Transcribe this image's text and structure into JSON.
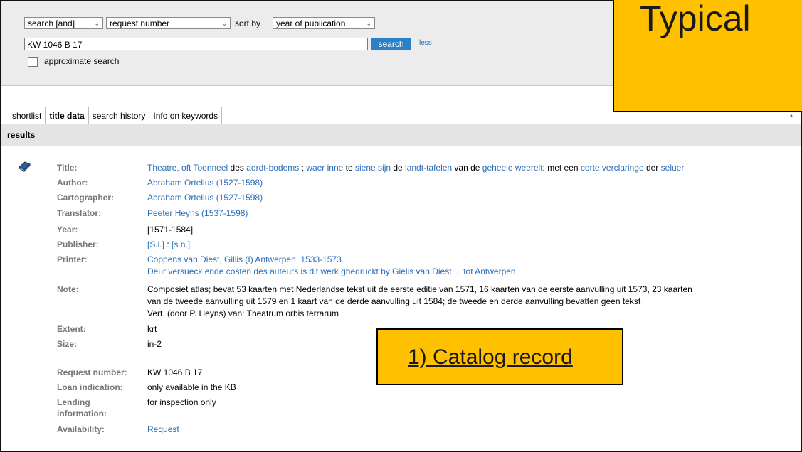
{
  "search": {
    "operator": "search [and]",
    "field": "request number",
    "sort_label": "sort by",
    "sort": "year of publication",
    "query": "KW 1046 B 17",
    "button": "search",
    "less": "less",
    "approximate": "approximate search"
  },
  "tabs": [
    {
      "label": "shortlist"
    },
    {
      "label": "title data"
    },
    {
      "label": "search history"
    },
    {
      "label": "Info on keywords"
    }
  ],
  "results_label": "results",
  "record": {
    "title_label": "Title:",
    "title_parts": [
      {
        "text": "Theatre, oft Toonneel",
        "link": true
      },
      {
        "text": " des ",
        "link": false
      },
      {
        "text": "aerdt-bodems",
        "link": true
      },
      {
        "text": " ; ",
        "link": false
      },
      {
        "text": "waer inne",
        "link": true
      },
      {
        "text": " te ",
        "link": false
      },
      {
        "text": "siene sijn",
        "link": true
      },
      {
        "text": " de ",
        "link": false
      },
      {
        "text": "landt-tafelen",
        "link": true
      },
      {
        "text": " van de ",
        "link": false
      },
      {
        "text": "geheele weerelt",
        "link": true
      },
      {
        "text": ": met een ",
        "link": false
      },
      {
        "text": "corte verclaringe",
        "link": true
      },
      {
        "text": " der ",
        "link": false
      },
      {
        "text": "seluer",
        "link": true
      }
    ],
    "author_label": "Author:",
    "author": "Abraham Ortelius (1527-1598)",
    "cartographer_label": "Cartographer:",
    "cartographer": "Abraham Ortelius (1527-1598)",
    "translator_label": "Translator:",
    "translator": "Peeter Heyns (1537-1598)",
    "year_label": "Year:",
    "year": "[1571-1584]",
    "publisher_label": "Publisher:",
    "publisher_a": "[S.l.]",
    "publisher_sep": " : ",
    "publisher_b": "[s.n.]",
    "printer_label": "Printer:",
    "printer_1": "Coppens van Diest, Gillis (I) Antwerpen, 1533-1573",
    "printer_2": "Deur versueck ende costen des auteurs is dit werk ghedruckt by Gielis van Diest ... tot Antwerpen",
    "note_label": "Note:",
    "note_1": "Composiet atlas; bevat 53 kaarten met Nederlandse tekst uit de eerste editie van 1571, 16 kaarten van de eerste aanvulling uit 1573, 23 kaarten",
    "note_2": "van de tweede aanvulling uit 1579 en 1 kaart van de derde aanvulling uit 1584; de tweede en derde aanvulling bevatten geen tekst",
    "note_3": "Vert. (door P. Heyns) van: Theatrum orbis terrarum",
    "extent_label": "Extent:",
    "extent": "krt",
    "size_label": "Size:",
    "size": "in-2",
    "request_label": "Request number:",
    "request": "KW 1046 B 17",
    "loan_label": "Loan indication:",
    "loan": "only available in the KB",
    "lending_label_1": "Lending",
    "lending_label_2": "information:",
    "lending": "for inspection only",
    "availability_label": "Availability:",
    "availability": "Request"
  },
  "overlay": {
    "typical": "Typical",
    "catalog": "1) Catalog record"
  },
  "colors": {
    "link": "#2a6db8",
    "button": "#2b7fc7",
    "highlight": "#ffc000"
  }
}
